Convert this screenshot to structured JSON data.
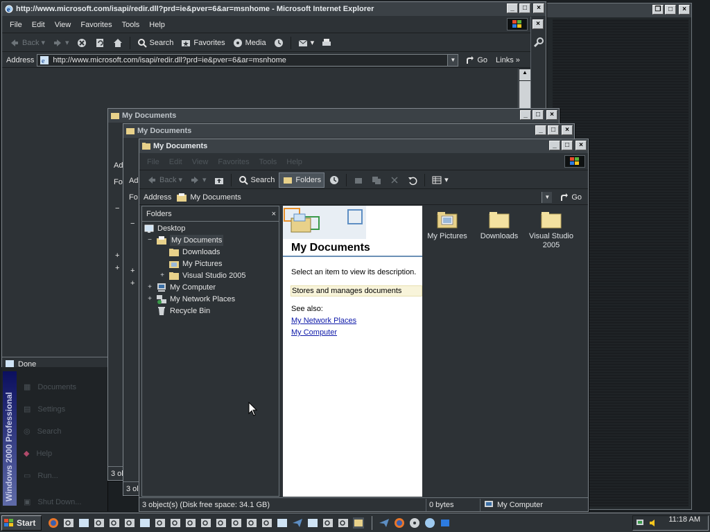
{
  "ie": {
    "title": "http://www.microsoft.com/isapi/redir.dll?prd=ie&pver=6&ar=msnhome - Microsoft Internet Explorer",
    "menu": [
      "File",
      "Edit",
      "View",
      "Favorites",
      "Tools",
      "Help"
    ],
    "toolbar": {
      "back": "Back",
      "search": "Search",
      "favorites": "Favorites",
      "media": "Media"
    },
    "address_label": "Address",
    "address_value": "http://www.microsoft.com/isapi/redir.dll?prd=ie&pver=6&ar=msnhome",
    "go": "Go",
    "links": "Links",
    "status": "Done"
  },
  "bg_windows": {
    "title1": "My Documents",
    "title2": "My Documents",
    "frag_address": "Ad",
    "frag_folders": "Fo",
    "status_frag": "3 ol"
  },
  "explorer": {
    "title": "My Documents",
    "menu": [
      "File",
      "Edit",
      "View",
      "Favorites",
      "Tools",
      "Help"
    ],
    "toolbar": {
      "back": "Back",
      "search": "Search",
      "folders": "Folders"
    },
    "address_label": "Address",
    "address_value": "My Documents",
    "go": "Go",
    "folders_header": "Folders",
    "tree": [
      {
        "label": "Desktop",
        "expander": ""
      },
      {
        "label": "My Documents",
        "expander": "−"
      },
      {
        "label": "Downloads",
        "expander": ""
      },
      {
        "label": "My Pictures",
        "expander": ""
      },
      {
        "label": "Visual Studio 2005",
        "expander": "+"
      },
      {
        "label": "My Computer",
        "expander": "+"
      },
      {
        "label": "My Network Places",
        "expander": "+"
      },
      {
        "label": "Recycle Bin",
        "expander": ""
      }
    ],
    "info": {
      "heading": "My Documents",
      "prompt": "Select an item to view its description.",
      "description": "Stores and manages documents",
      "see_also": "See also:",
      "links": [
        "My Network Places",
        "My Computer"
      ]
    },
    "files": [
      {
        "label": "My Pictures",
        "icon": "folder-pictures-icon"
      },
      {
        "label": "Downloads",
        "icon": "folder-icon"
      },
      {
        "label": "Visual Studio 2005",
        "icon": "folder-icon"
      }
    ],
    "status": {
      "objects": "3 object(s) (Disk free space: 34.1 GB)",
      "size": "0 bytes",
      "location": "My Computer"
    }
  },
  "startmenu": {
    "banner": "Windows 2000 Professional",
    "items": [
      "Documents",
      "Settings",
      "Search",
      "Help",
      "Run...",
      "Shut Down..."
    ]
  },
  "taskbar": {
    "start": "Start",
    "clock": "11:18 AM"
  },
  "colors": {
    "desktop": "#1b1f22",
    "window": "#2d3236",
    "title": "#3b4146",
    "accent": "#6b8fb5",
    "link": "#0b17a8"
  }
}
